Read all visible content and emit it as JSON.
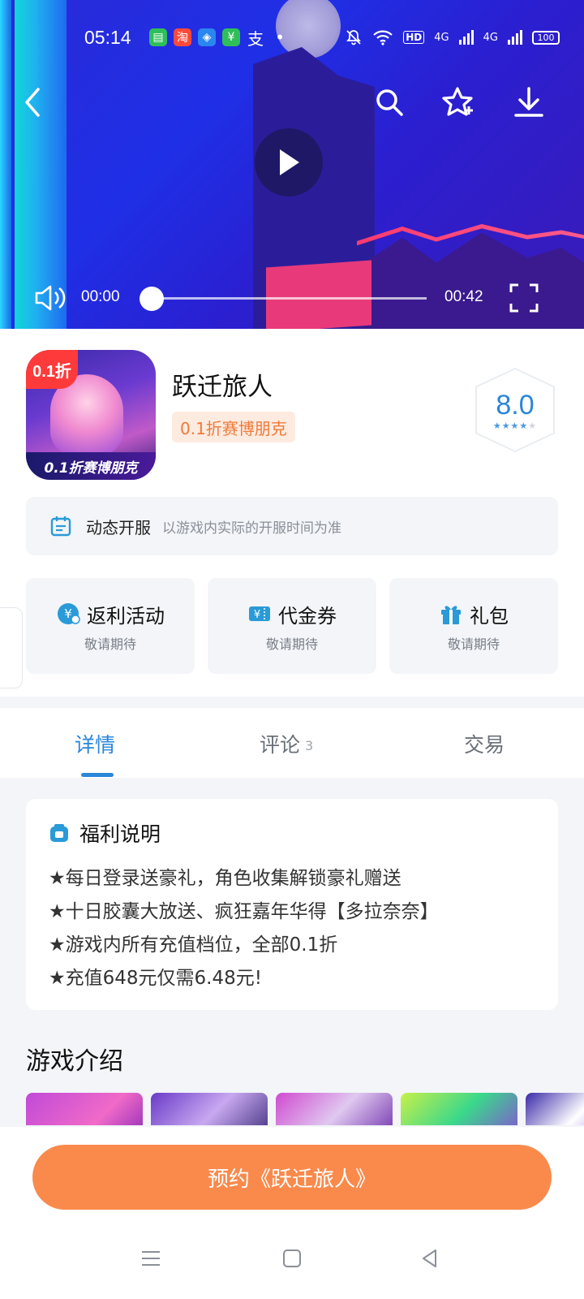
{
  "status_bar": {
    "time": "05:14",
    "apps": [
      {
        "name": "message-app-icon",
        "glyph": "▤",
        "color": "#2fbf5a"
      },
      {
        "name": "taobao-app-icon",
        "glyph": "淘",
        "color": "#ff4a3a"
      },
      {
        "name": "browser-app-icon",
        "glyph": "◈",
        "color": "#2a86f0"
      },
      {
        "name": "wallet-app-icon",
        "glyph": "¥",
        "color": "#2fbf5a"
      },
      {
        "name": "alipay-app-icon",
        "glyph": "支",
        "color": "transparent"
      }
    ],
    "network": "4G",
    "hd": "HD",
    "battery": "100"
  },
  "video": {
    "current_time": "00:00",
    "duration": "00:42",
    "progress": 0.0
  },
  "game": {
    "title": "跃迁旅人",
    "tag": "0.1折赛博朋克",
    "rating": "8.0",
    "rating_stars": 4,
    "icon_badge": "0.1折",
    "icon_banner": "0.1折赛博朋克"
  },
  "server": {
    "label": "动态开服",
    "note": "以游戏内实际的开服时间为准"
  },
  "benefits": [
    {
      "title": "返利活动",
      "sub": "敬请期待",
      "icon": "rebate-icon"
    },
    {
      "title": "代金券",
      "sub": "敬请期待",
      "icon": "voucher-icon"
    },
    {
      "title": "礼包",
      "sub": "敬请期待",
      "icon": "gift-icon"
    }
  ],
  "tabs": [
    {
      "label": "详情",
      "active": true
    },
    {
      "label": "评论",
      "count": "3"
    },
    {
      "label": "交易"
    }
  ],
  "welfare": {
    "title": "福利说明",
    "lines": [
      "★每日登录送豪礼，角色收集解锁豪礼赠送",
      "★十日胶囊大放送、疯狂嘉年华得【多拉奈奈】",
      "★游戏内所有充值档位，全部0.1折",
      "★充值648元仅需6.48元!"
    ]
  },
  "intro": {
    "title": "游戏介绍"
  },
  "reserve_button": "预约《跃迁旅人》",
  "colors": {
    "accent": "#2a86d8",
    "reserve": "#f98a4c",
    "tag_text": "#f07a3a",
    "tag_bg": "#fdebe0"
  }
}
